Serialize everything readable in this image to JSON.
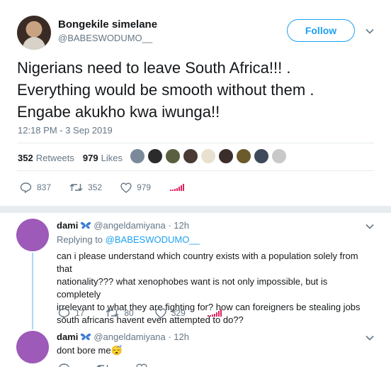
{
  "main_tweet": {
    "author_name": "Bongekile simelane",
    "author_handle": "@BABESWODUMO__",
    "follow_label": "Follow",
    "text_lines": [
      "Nigerians need to leave South Africa!!! .",
      "Everything would be smooth without them .",
      "Engabe akukho kwa iwunga!!"
    ],
    "timestamp": "12:18 PM - 3 Sep 2019",
    "retweets_count": "352",
    "retweets_label": "Retweets",
    "likes_count": "979",
    "likes_label": "Likes",
    "actions": {
      "replies": "837",
      "retweets": "352",
      "likes": "979"
    }
  },
  "replies": [
    {
      "name": "dami",
      "handle": "@angeldamiyana",
      "time": "· 12h",
      "replying_prefix": "Replying to",
      "replying_to": "@BABESWODUMO__",
      "text_lines": [
        "can i please understand which country exists with a population solely from that",
        "nationality??? what xenophobes want is not only impossible, but is completely",
        "irrelevant to what they are fighting for? how can foreigners be stealing jobs",
        "south africans havent even attempted to do??"
      ],
      "actions": {
        "replies": "17",
        "retweets": "80",
        "likes": "329"
      }
    },
    {
      "name": "dami",
      "handle": "@angeldamiyana",
      "time": "· 12h",
      "text": "dont bore me",
      "emoji": "😴"
    }
  ],
  "colors": {
    "accent": "#1da1f2",
    "muted": "#657786",
    "reply_avatar": "#9d5ab8",
    "thread_line": "#a7d8f7"
  }
}
